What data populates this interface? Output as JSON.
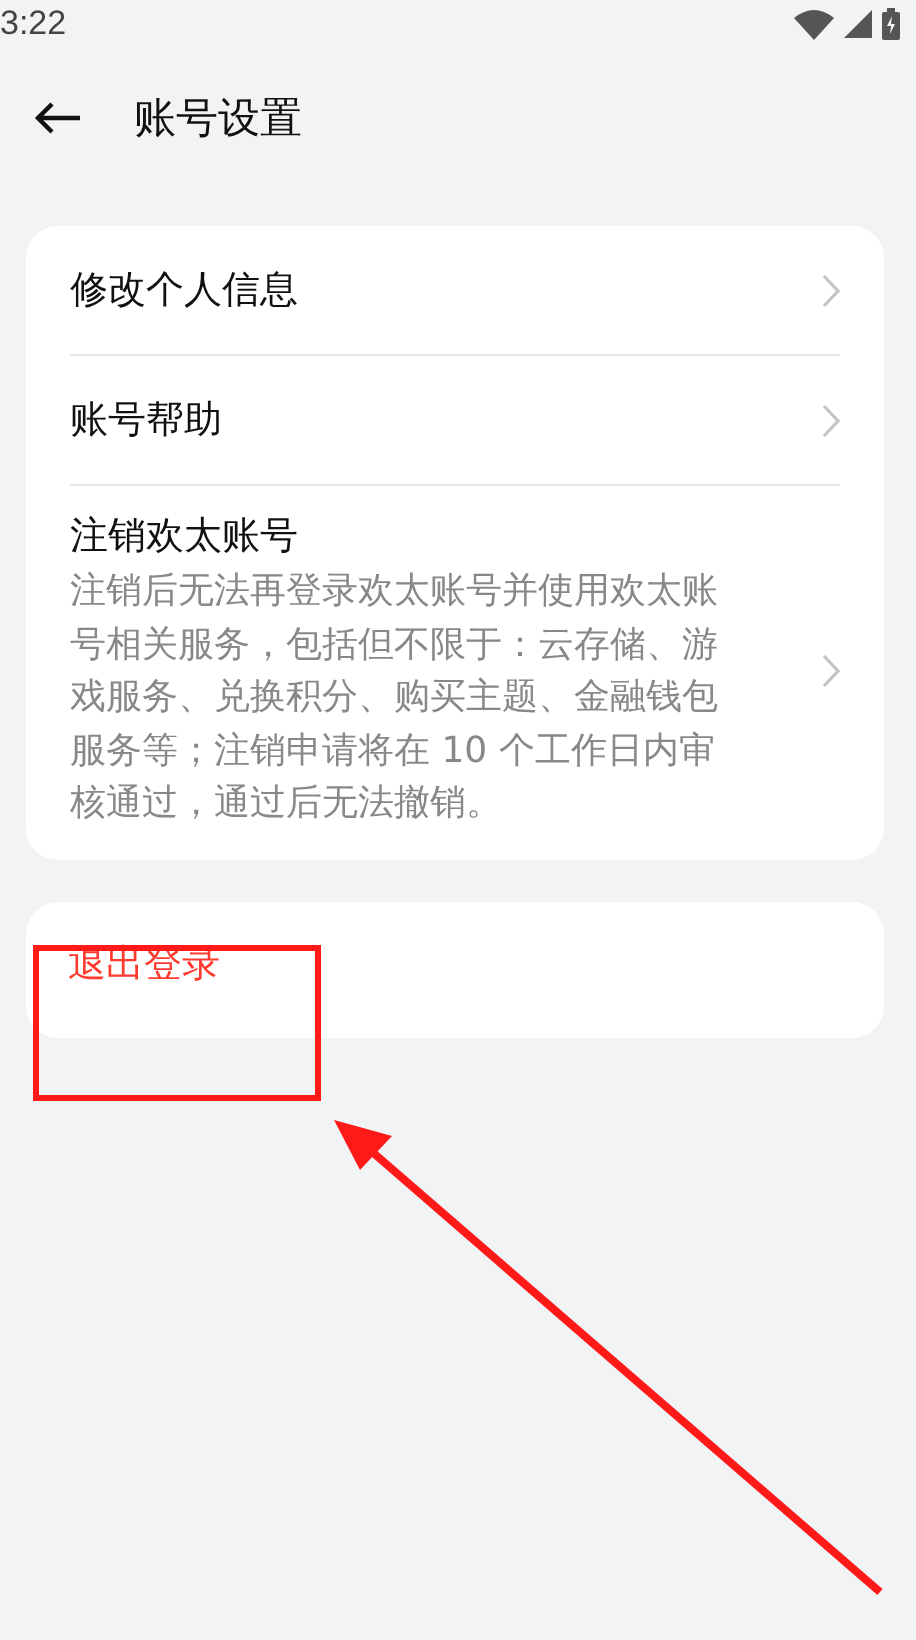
{
  "status_bar": {
    "time": "3:22"
  },
  "header": {
    "title": "账号设置"
  },
  "settings": [
    {
      "kind": "plain",
      "label": "修改个人信息"
    },
    {
      "kind": "plain",
      "label": "账号帮助"
    },
    {
      "kind": "described",
      "label": "注销欢太账号",
      "description": "注销后无法再登录欢太账号并使用欢太账号相关服务，包括但不限于：云存储、游戏服务、兑换积分、购买主题、金融钱包服务等；注销申请将在 10 个工作日内审核通过，通过后无法撤销。"
    }
  ],
  "logout": {
    "label": "退出登录"
  }
}
